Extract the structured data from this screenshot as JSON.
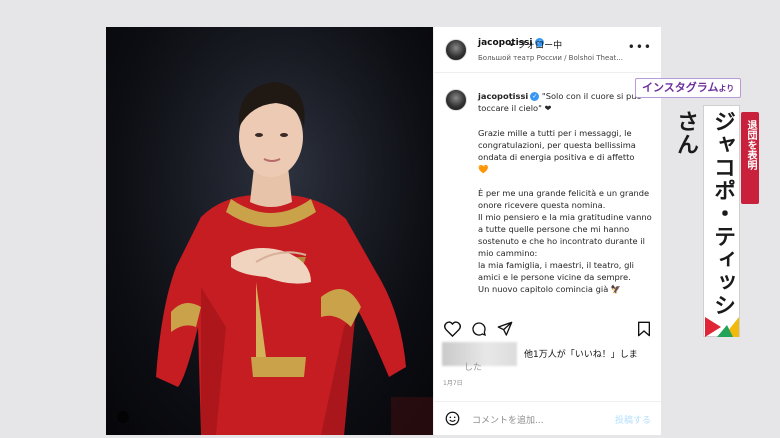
{
  "post": {
    "username": "jacopotissi",
    "follow_status": "• フォロー中",
    "location": "Большой театр России / Bolshoi Theat...",
    "more_icon": "more-horizontal-icon",
    "caption": {
      "username": "jacopotissi",
      "intro": "\"Solo con il cuore si può toccare il cielo\" ❤",
      "lines": [
        "Grazie mille a tutti per i messaggi, le congratulazioni, per questa bellissima ondata di energia positiva e di affetto",
        "🧡",
        "",
        "È per me una grande felicità e un grande onore ricevere questa nomina.",
        "Il mio pensiero e la mia gratitudine vanno a tutte quelle persone che mi hanno sostenuto e che ho incontrato durante il mio cammino:",
        "la mia famiglia, i maestri, il teatro, gli amici e le persone vicine da sempre.",
        "Un nuovo capitolo comincia già 🦅"
      ]
    },
    "actions": {
      "like_icon": "heart-icon",
      "comment_icon": "comment-icon",
      "share_icon": "send-icon",
      "save_icon": "bookmark-icon"
    },
    "likes_line1": "他1万人が「いいね！」しま",
    "likes_line2": "した",
    "date": "1月7日",
    "comment_placeholder": "コメントを追加...",
    "post_button": "投稿する",
    "emoji_icon": "emoji-icon"
  },
  "overlay": {
    "source_badge": "インスタグラム",
    "source_badge_suffix": "より",
    "vertical_title": "ジャコポ・ティッシさん",
    "vertical_sub": "退団を表明"
  },
  "colors": {
    "accent_purple": "#6d2f9c",
    "badge_red": "#c9213b",
    "verified_blue": "#3897f0"
  }
}
